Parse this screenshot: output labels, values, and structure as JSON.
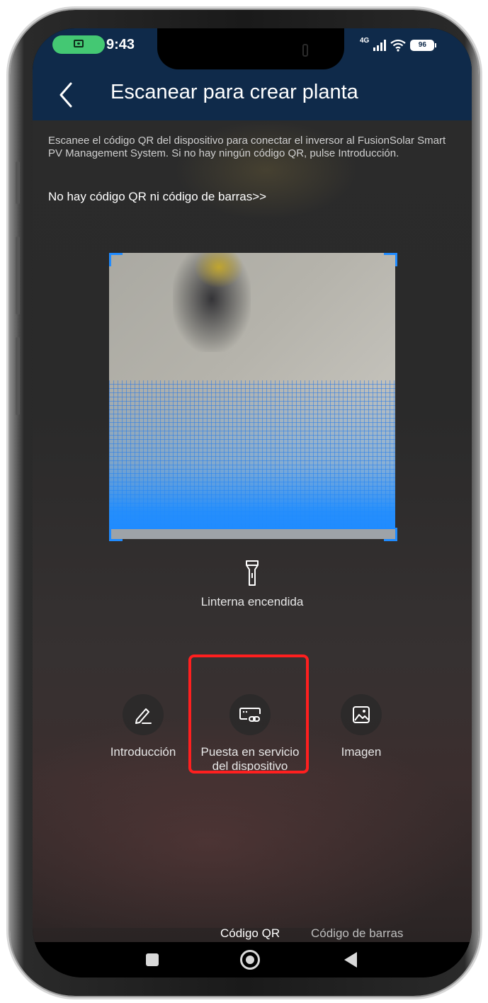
{
  "status_bar": {
    "time": "9:43",
    "network": "4G",
    "battery": "96"
  },
  "header": {
    "title": "Escanear para crear planta"
  },
  "instructions": {
    "description": "Escanee el código QR del dispositivo para conectar el inversor al FusionSolar Smart PV Management System. Si no hay ningún código QR, pulse Introducción.",
    "no_code_link": "No hay código QR ni código de barras>>"
  },
  "flashlight": {
    "label": "Linterna encendida"
  },
  "actions": [
    {
      "label": "Introducción",
      "icon": "pencil-icon"
    },
    {
      "label": "Puesta en servicio del dispositivo",
      "icon": "device-link-icon",
      "highlighted": true
    },
    {
      "label": "Imagen",
      "icon": "image-icon"
    }
  ],
  "scan_tabs": [
    {
      "label": "Código QR",
      "active": true
    },
    {
      "label": "Código de barras",
      "active": false
    }
  ],
  "colors": {
    "header_bg": "#0f2a4a",
    "accent": "#1f8bff",
    "highlight": "#ff1f1f",
    "camera_pill": "#44c873"
  }
}
